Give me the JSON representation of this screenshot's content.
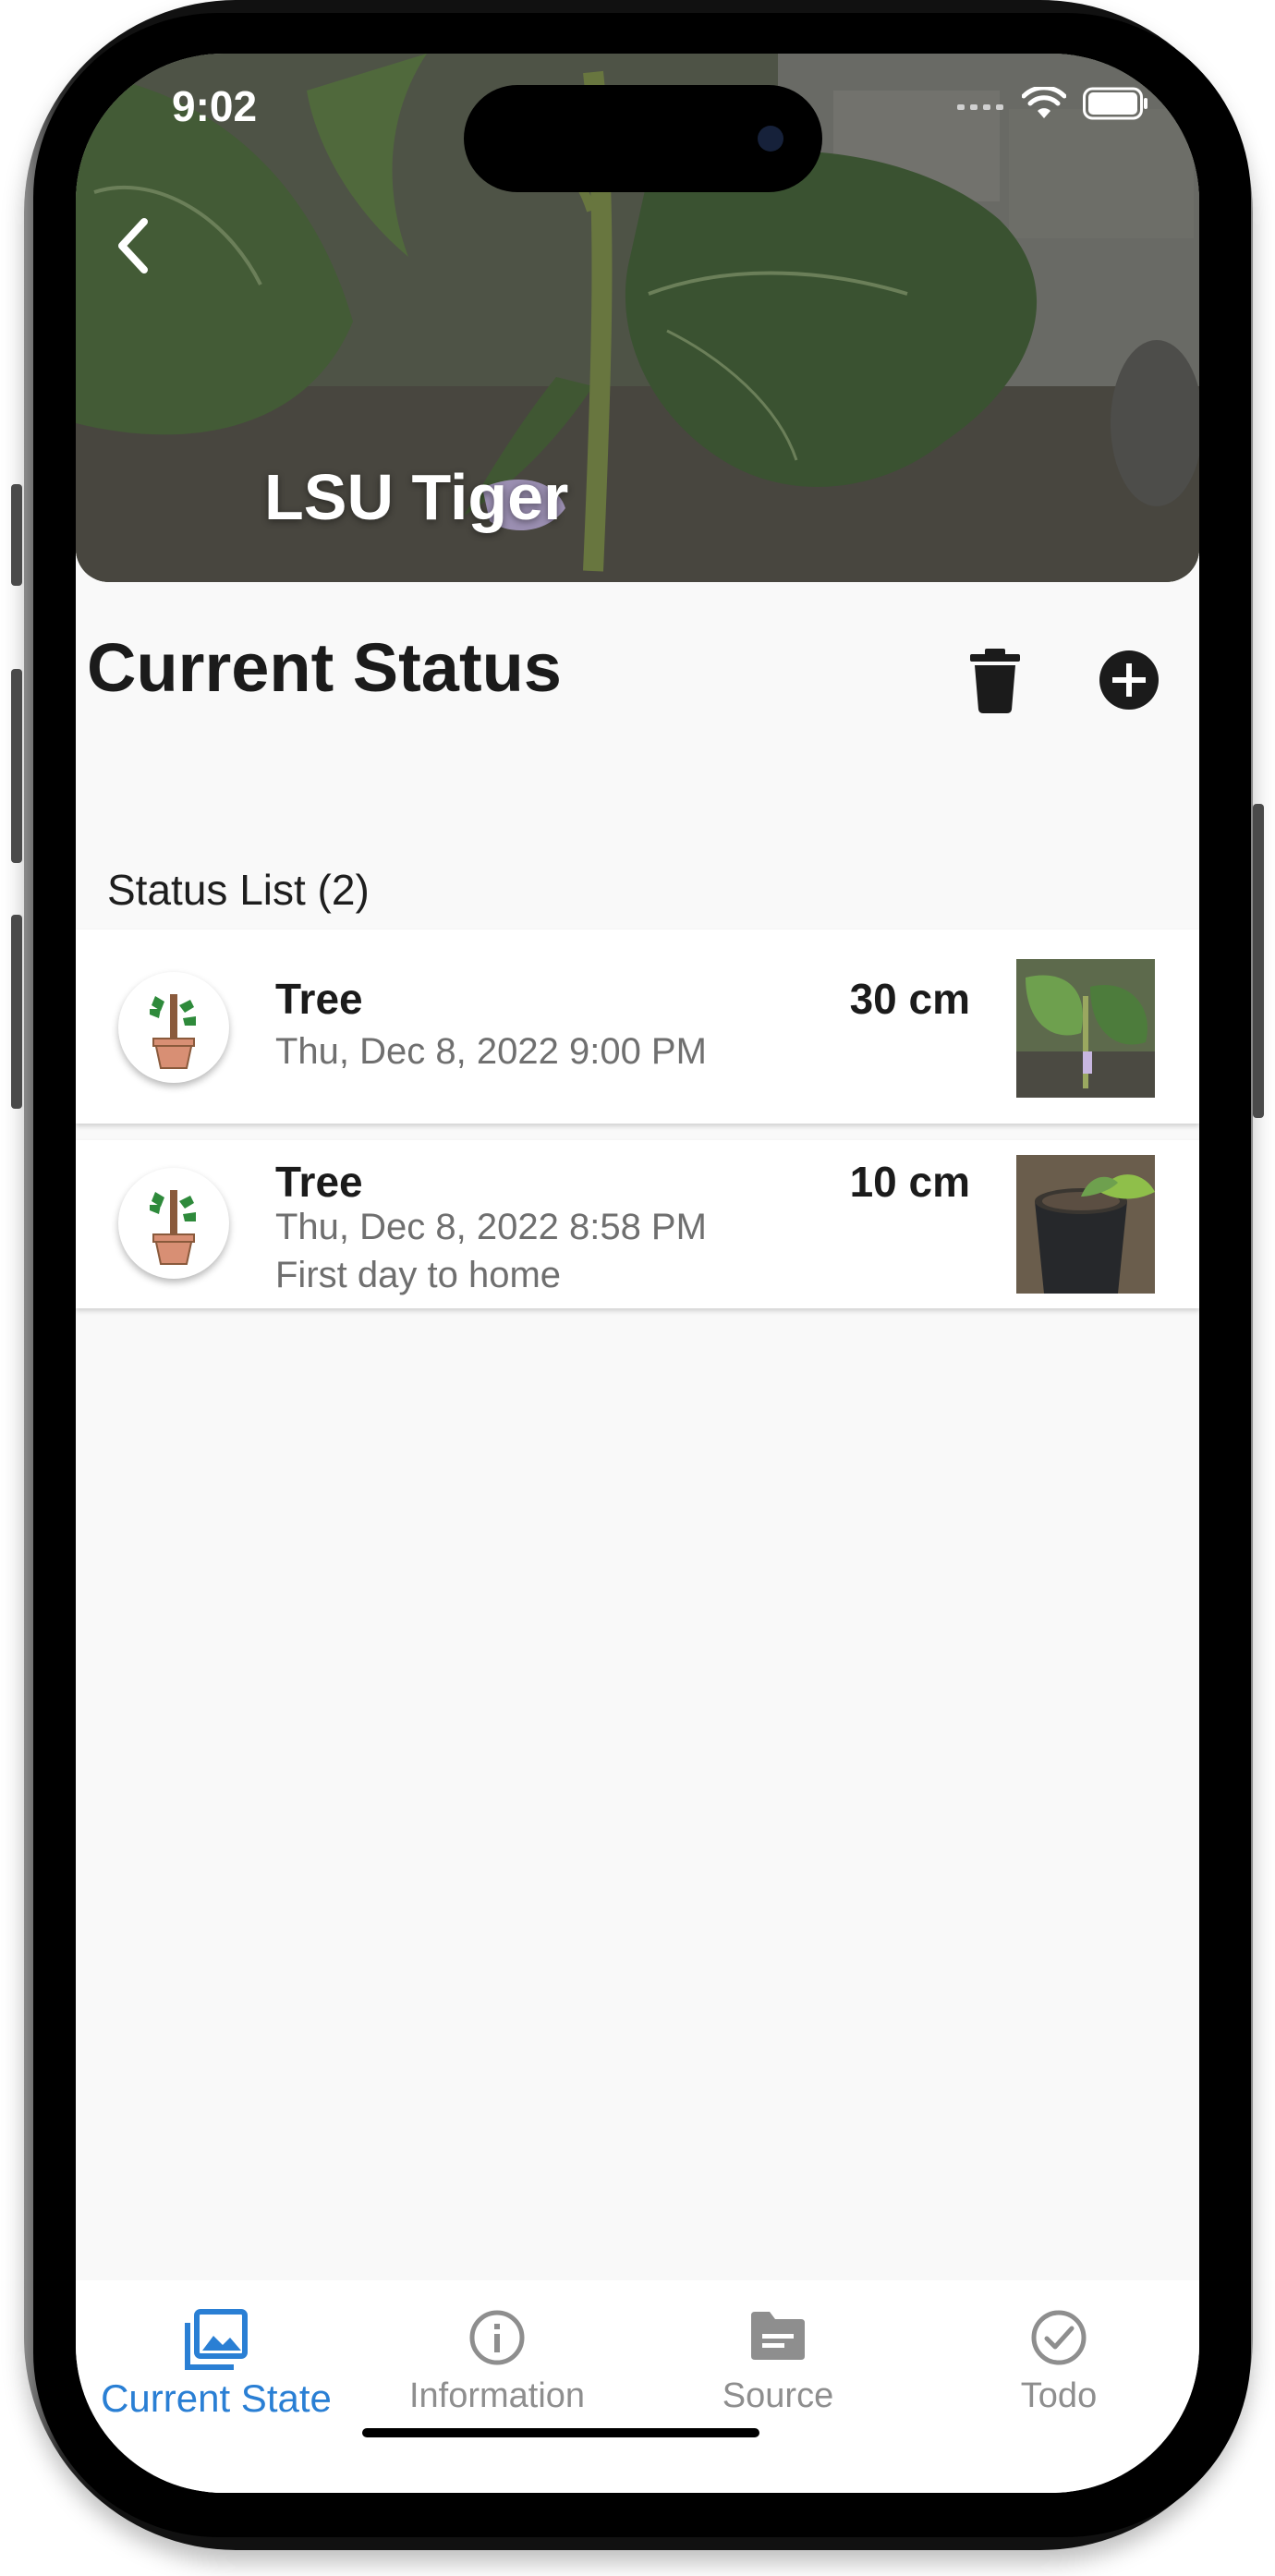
{
  "status_bar": {
    "time": "9:02"
  },
  "header": {
    "title": "LSU Tiger"
  },
  "section": {
    "title": "Current Status",
    "list_label": "Status List (2)"
  },
  "items": [
    {
      "name": "Tree",
      "date": "Thu, Dec 8, 2022 9:00 PM",
      "note": "",
      "size": "30 cm"
    },
    {
      "name": "Tree",
      "date": "Thu, Dec 8, 2022 8:58 PM",
      "note": "First day to home",
      "size": "10 cm"
    }
  ],
  "nav": [
    {
      "label": "Current State",
      "icon": "gallery-icon",
      "active": true
    },
    {
      "label": "Information",
      "icon": "info-icon",
      "active": false
    },
    {
      "label": "Source",
      "icon": "folder-icon",
      "active": false
    },
    {
      "label": "Todo",
      "icon": "check-circle-icon",
      "active": false
    }
  ],
  "colors": {
    "accent": "#2a7fd4",
    "inactive": "#8e8e8e",
    "background": "#f9f9f9"
  }
}
